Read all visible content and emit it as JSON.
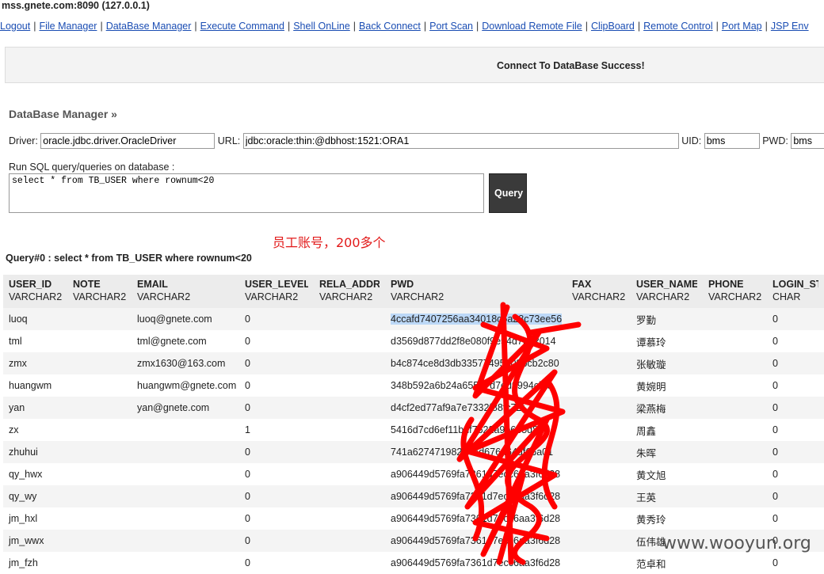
{
  "window": {
    "title": "mss.gnete.com:8090 (127.0.0.1)"
  },
  "nav": [
    "Logout",
    "File Manager",
    "DataBase Manager",
    "Execute Command",
    "Shell OnLine",
    "Back Connect",
    "Port Scan",
    "Download Remote File",
    "ClipBoard",
    "Remote Control",
    "Port Map",
    "JSP Env"
  ],
  "message": "Connect To DataBase Success!",
  "db": {
    "title": "DataBase Manager »",
    "driver_label": "Driver:",
    "driver_value": "oracle.jdbc.driver.OracleDriver",
    "url_label": "URL:",
    "url_value": "jdbc:oracle:thin:@dbhost:1521:ORA1",
    "uid_label": "UID:",
    "uid_value": "bms",
    "pwd_label": "PWD:",
    "pwd_value": "bms",
    "run_label": "Run SQL query/queries on database :",
    "sql": "select * from TB_USER where rownum<20",
    "query_button": "Query"
  },
  "annotation": "员工账号，200多个",
  "query_label": "Query#0 : select * from TB_USER where rownum<20",
  "columns": [
    {
      "name": "USER_ID",
      "type": "VARCHAR2"
    },
    {
      "name": "NOTE",
      "type": "VARCHAR2"
    },
    {
      "name": "EMAIL",
      "type": "VARCHAR2"
    },
    {
      "name": "USER_LEVEL",
      "type": "VARCHAR2"
    },
    {
      "name": "RELA_ADDR",
      "type": "VARCHAR2"
    },
    {
      "name": "PWD",
      "type": "VARCHAR2"
    },
    {
      "name": "FAX",
      "type": "VARCHAR2"
    },
    {
      "name": "USER_NAME",
      "type": "VARCHAR2"
    },
    {
      "name": "PHONE",
      "type": "VARCHAR2"
    },
    {
      "name": "LOGIN_STA",
      "type": "CHAR"
    }
  ],
  "rows": [
    [
      "luoq",
      "",
      "luoq@gnete.com",
      "0",
      "",
      "4ccafd7407256aa34018c5a28c73ee56",
      "",
      "罗勤",
      "",
      "0"
    ],
    [
      "tml",
      "",
      "tml@gnete.com",
      "0",
      "",
      "d3569d877dd2f8e080f9e54d7e52014",
      "",
      "谭慕玲",
      "",
      "0"
    ],
    [
      "zmx",
      "",
      "zmx1630@163.com",
      "0",
      "",
      "b4c874ce8d3db33577495808bcb2c80",
      "",
      "张敏璇",
      "",
      "0"
    ],
    [
      "huangwm",
      "",
      "huangwm@gnete.com",
      "0",
      "",
      "348b592a6b24a65587d7ed9994cba",
      "",
      "黄婉明",
      "",
      "0"
    ],
    [
      "yan",
      "",
      "yan@gnete.com",
      "0",
      "",
      "d4cf2ed77af9a7e7332f88fc72f",
      "",
      "梁燕梅",
      "",
      "0"
    ],
    [
      "zx",
      "",
      "",
      "1",
      "",
      "5416d7cd6ef11bdf7622a9b6b5d84",
      "",
      "周鑫",
      "",
      "0"
    ],
    [
      "zhuhui",
      "",
      "",
      "0",
      "",
      "741a627471982d44d676d64df66a01",
      "",
      "朱晖",
      "",
      "0"
    ],
    [
      "qy_hwx",
      "",
      "",
      "0",
      "",
      "a906449d5769fa7361d7ecc6aa3f6d28",
      "",
      "黄文旭",
      "",
      "0"
    ],
    [
      "qy_wy",
      "",
      "",
      "0",
      "",
      "a906449d5769fa7361d7ecc6aa3f6d28",
      "",
      "王英",
      "",
      "0"
    ],
    [
      "jm_hxl",
      "",
      "",
      "0",
      "",
      "a906449d5769fa7361d7ecc6aa3f6d28",
      "",
      "黄秀玲",
      "",
      "0"
    ],
    [
      "jm_wwx",
      "",
      "",
      "0",
      "",
      "a906449d5769fa7361d7ecc6aa3f6d28",
      "",
      "伍伟雄",
      "",
      "0"
    ],
    [
      "jm_fzh",
      "",
      "",
      "0",
      "",
      "a906449d5769fa7361d7ecc6aa3f6d28",
      "",
      "范卓和",
      "",
      "0"
    ]
  ],
  "watermark": "www.wooyun.org",
  "colors": {
    "annotation": "#e21a1a",
    "link": "#1a4db3",
    "selection": "#bcd8f7",
    "scribble": "#ff0000"
  }
}
